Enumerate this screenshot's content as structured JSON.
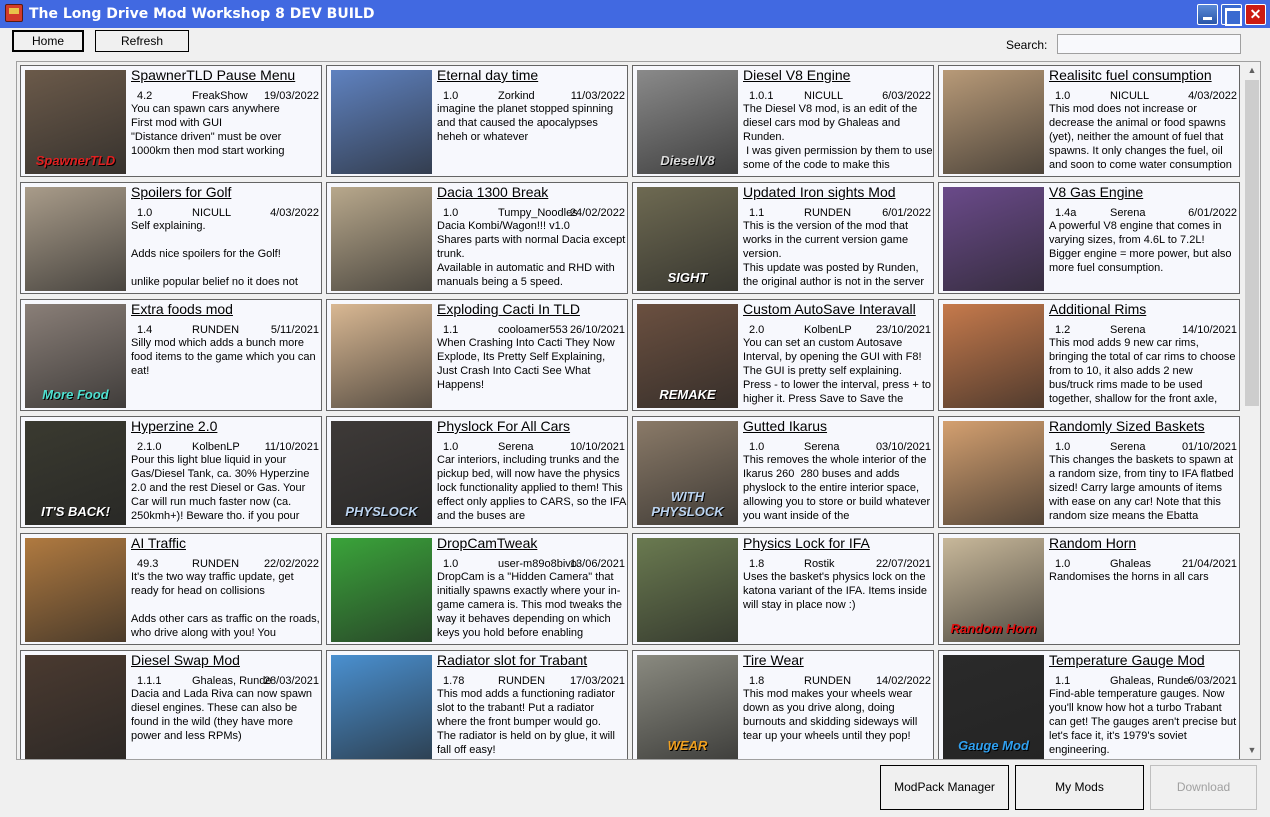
{
  "window": {
    "title": "The Long Drive Mod Workshop 8 DEV BUILD",
    "close_glyph": "✕"
  },
  "toolbar": {
    "home": "Home",
    "refresh": "Refresh",
    "search_label": "Search:",
    "search_value": ""
  },
  "footer": {
    "modpack": "ModPack Manager",
    "mymods": "My Mods",
    "download": "Download"
  },
  "scroll": {
    "up": "▲",
    "down": "▼"
  },
  "mods": [
    {
      "title": "SpawnerTLD Pause Menu",
      "version": "4.2",
      "author": "FreakShow",
      "date": "19/03/2022",
      "desc": "You can spawn cars anywhere\nFirst mod with GUI\n\"Distance driven\" must be over 1000km then mod start working",
      "thumb": "#6b5a4a",
      "thumb_text": "SpawnerTLD",
      "thumb_color": "#e02020"
    },
    {
      "title": "Eternal day time",
      "version": "1.0",
      "author": "Zorkind",
      "date": "11/03/2022",
      "desc": "imagine the planet stopped spinning and that caused the apocalypses heheh or whatever",
      "thumb": "#5f82c0",
      "thumb_text": "",
      "thumb_color": "#fff"
    },
    {
      "title": "Diesel V8 Engine",
      "version": "1.0.1",
      "author": "NICULL",
      "date": "6/03/2022",
      "desc": "The Diesel V8 mod, is an edit of the diesel cars mod by Ghaleas and Runden.\n I was given permission by them to use some of the code to make this",
      "thumb": "#8a8a8a",
      "thumb_text": "DieselV8",
      "thumb_color": "#ddd"
    },
    {
      "title": "Realisitc fuel consumption",
      "version": "1.0",
      "author": "NICULL",
      "date": "4/03/2022",
      "desc": "This mod does not increase or decrease the animal or food spawns (yet), neither the amount of fuel that spawns. It only changes the fuel, oil and soon to come water consumption",
      "thumb": "#b89a78",
      "thumb_text": "",
      "thumb_color": "#fff"
    },
    {
      "title": "Spoilers for Golf",
      "version": "1.0",
      "author": "NICULL",
      "date": "4/03/2022",
      "desc": "Self explaining.\n\nAdds nice spoilers for the Golf!\n\nunlike popular belief no it does not",
      "thumb": "#a99c8a",
      "thumb_text": "",
      "thumb_color": "#fff"
    },
    {
      "title": "Dacia 1300 Break",
      "version": "1.0",
      "author": "Tumpy_Noodles / ",
      "date": "24/02/2022",
      "desc": "Dacia Kombi/Wagon!!! v1.0\nShares parts with normal Dacia except trunk.\nAvailable in automatic and RHD with manuals being a 5 speed.",
      "thumb": "#b8a88c",
      "thumb_text": "",
      "thumb_color": "#fff"
    },
    {
      "title": "Updated Iron sights Mod",
      "version": "1.1",
      "author": "RUNDEN",
      "date": "6/01/2022",
      "desc": "This is the version of the mod that works in the current version game version.\nThis update was posted by Runden, the original author is not in the server",
      "thumb": "#6e6a52",
      "thumb_text": "SIGHT",
      "thumb_color": "#fff"
    },
    {
      "title": "V8 Gas Engine",
      "version": "1.4a",
      "author": "Serena",
      "date": "6/01/2022",
      "desc": "A powerful V8 engine that comes in varying sizes, from 4.6L to 7.2L!\nBigger engine = more power, but also more fuel consumption.",
      "thumb": "#6a4a8a",
      "thumb_text": "",
      "thumb_color": "#fff"
    },
    {
      "title": "Extra foods mod",
      "version": "1.4",
      "author": "RUNDEN",
      "date": "5/11/2021",
      "desc": "Silly mod which adds a bunch more food items to the game which you can eat!",
      "thumb": "#8a7f78",
      "thumb_text": "More Food",
      "thumb_color": "#4fe0d0"
    },
    {
      "title": "Exploding Cacti In TLD",
      "version": "1.1",
      "author": "cooloamer553",
      "date": "26/10/2021",
      "desc": "When Crashing Into Cacti They Now Explode, Its Pretty Self Explaining, Just Crash Into Cacti See What Happens!",
      "thumb": "#d9b893",
      "thumb_text": "",
      "thumb_color": "#fff"
    },
    {
      "title": "Custom AutoSave Interavall",
      "version": "2.0",
      "author": "KolbenLP",
      "date": "23/10/2021",
      "desc": "You can set an custom Autosave Interval, by opening the GUI with F8!\nThe GUI is pretty self explaining.\nPress - to lower the interval, press + to higher it. Press Save to Save the",
      "thumb": "#6b5040",
      "thumb_text": "REMAKE",
      "thumb_color": "#fff"
    },
    {
      "title": "Additional Rims",
      "version": "1.2",
      "author": "Serena",
      "date": "14/10/2021",
      "desc": "This mod adds 9 new car rims, bringing the total of car rims to choose from to 10, it also adds 2 new bus/truck rims made to be used together, shallow for the front axle,",
      "thumb": "#c67a4c",
      "thumb_text": "",
      "thumb_color": "#fff"
    },
    {
      "title": "Hyperzine 2.0",
      "version": "2.1.0",
      "author": "KolbenLP",
      "date": "11/10/2021",
      "desc": "Pour this light blue liquid in your Gas/Diesel Tank, ca. 30% Hyperzine 2.0 and the rest Diesel or Gas. Your Car will run much faster now (ca. 250kmh+)! Beware tho. if you pour",
      "thumb": "#3a3a30",
      "thumb_text": "IT'S BACK!",
      "thumb_color": "#fff"
    },
    {
      "title": "Physlock For All Cars",
      "version": "1.0",
      "author": "Serena",
      "date": "10/10/2021",
      "desc": "Car interiors, including trunks and the pickup bed, will now have the physics lock functionality applied to them! This effect only applies to CARS, so the IFA and the buses are",
      "thumb": "#3e3a38",
      "thumb_text": "PHYSLOCK",
      "thumb_color": "#bcd4f0"
    },
    {
      "title": "Gutted Ikarus",
      "version": "1.0",
      "author": "Serena",
      "date": "03/10/2021",
      "desc": "This removes the whole interior of the Ikarus 260  280 buses and adds physlock to the entire interior space, allowing you to store or build whatever you want inside of the",
      "thumb": "#8a7a68",
      "thumb_text": "WITH PHYSLOCK",
      "thumb_color": "#bcd4f0"
    },
    {
      "title": "Randomly Sized Baskets",
      "version": "1.0",
      "author": "Serena",
      "date": "01/10/2021",
      "desc": "This changes the baskets to spawn at a random size, from tiny to IFA flatbed sized! Carry large amounts of items with ease on any car! Note that this random size means the Ebatta",
      "thumb": "#d4a070",
      "thumb_text": "",
      "thumb_color": "#fff"
    },
    {
      "title": "AI Traffic",
      "version": "49.3",
      "author": "RUNDEN",
      "date": "22/02/2022",
      "desc": "It's the two way traffic update, get ready for head on collisions\n\nAdds other cars as traffic on the roads, who drive along with you! You",
      "thumb": "#b07a40",
      "thumb_text": "",
      "thumb_color": "#fff"
    },
    {
      "title": "DropCamTweak",
      "version": "1.0",
      "author": "user-m89o8bivor",
      "date": "13/06/2021",
      "desc": "DropCam is a \"Hidden Camera\" that initially spawns exactly where your in-game camera is. This mod tweaks the way it behaves depending on which keys you hold before enabling",
      "thumb": "#3aa43a",
      "thumb_text": "",
      "thumb_color": "#fff"
    },
    {
      "title": "Physics Lock for IFA",
      "version": "1.8",
      "author": "Rostik",
      "date": "22/07/2021",
      "desc": "Uses the basket's physics lock on the katona variant of the IFA. Items inside will stay in place now :)",
      "thumb": "#6a7a50",
      "thumb_text": "",
      "thumb_color": "#fff"
    },
    {
      "title": "Random Horn",
      "version": "1.0",
      "author": "Ghaleas",
      "date": "21/04/2021",
      "desc": "Randomises the horns in all cars",
      "thumb": "#c8b89a",
      "thumb_text": "Random Horn",
      "thumb_color": "#e01010"
    },
    {
      "title": "Diesel Swap Mod",
      "version": "1.1.1",
      "author": "Ghaleas, Runden",
      "date": "28/03/2021",
      "desc": "Dacia and Lada Riva can now spawn diesel engines. These can also be found in the wild (they have more power and less RPMs)",
      "thumb": "#4a3a30",
      "thumb_text": "",
      "thumb_color": "#fff"
    },
    {
      "title": "Radiator slot for Trabant",
      "version": "1.78",
      "author": "RUNDEN",
      "date": "17/03/2021",
      "desc": "This mod adds a functioning radiator slot to the trabant! Put a radiator where the front bumper would go.\nThe radiator is held on by glue, it will fall off easy!",
      "thumb": "#4a90d0",
      "thumb_text": "",
      "thumb_color": "#fff"
    },
    {
      "title": "Tire Wear",
      "version": "1.8",
      "author": "RUNDEN",
      "date": "14/02/2022",
      "desc": "This mod makes your wheels wear down as you drive along, doing burnouts and skidding sideways will tear up your wheels until they pop!",
      "thumb": "#8a8a80",
      "thumb_text": "WEAR",
      "thumb_color": "#f0a020"
    },
    {
      "title": "Temperature Gauge Mod",
      "version": "1.1",
      "author": "Ghaleas, Runden",
      "date": "6/03/2021",
      "desc": "Find-able temperature gauges. Now you'll know how hot a turbo Trabant can get! The gauges aren't precise but let's face it, it's 1979's soviet engineering.",
      "thumb": "#2a2a2a",
      "thumb_text": "Gauge Mod",
      "thumb_color": "#30a0f0"
    }
  ]
}
